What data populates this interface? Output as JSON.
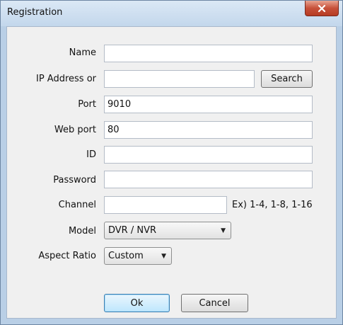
{
  "window": {
    "title": "Registration",
    "close_icon": "close-icon"
  },
  "form": {
    "name": {
      "label": "Name",
      "value": ""
    },
    "ip_address": {
      "label": "IP Address or",
      "value": ""
    },
    "search_button": "Search",
    "port": {
      "label": "Port",
      "value": "9010"
    },
    "web_port": {
      "label": "Web port",
      "value": "80"
    },
    "id": {
      "label": "ID",
      "value": ""
    },
    "password": {
      "label": "Password",
      "value": ""
    },
    "channel": {
      "label": "Channel",
      "value": "",
      "hint": "Ex) 1-4, 1-8, 1-16"
    },
    "model": {
      "label": "Model",
      "selected": "DVR / NVR"
    },
    "aspect_ratio": {
      "label": "Aspect Ratio",
      "selected": "Custom"
    }
  },
  "buttons": {
    "ok": "Ok",
    "cancel": "Cancel"
  },
  "colors": {
    "close_button": "#c7513a",
    "default_button_border": "#3c7fb1",
    "frame": "#b9cfe6"
  }
}
